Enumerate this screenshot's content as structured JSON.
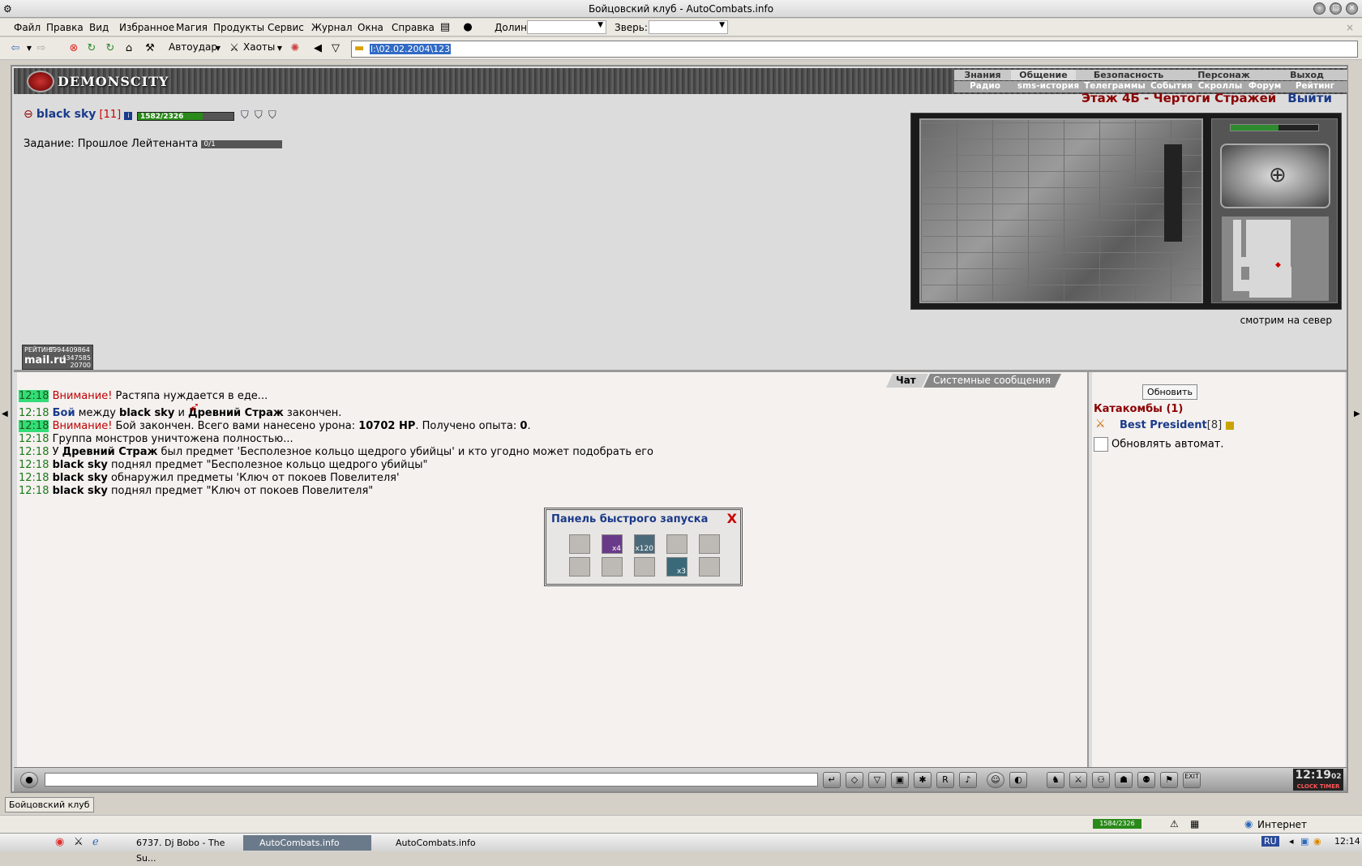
{
  "window": {
    "title": "Бойцовский клуб - AutoCombats.info"
  },
  "menubar": {
    "items": [
      "Файл",
      "Правка",
      "Вид",
      "Избранное",
      "Магия",
      "Продукты",
      "Сервис",
      "Журнал",
      "Окна",
      "Справка"
    ],
    "dolin_label": "Долин:",
    "zver_label": "Зверь:"
  },
  "toolbar": {
    "autoudar_label": "Автоудар",
    "haoty_label": "Хаоты",
    "address_value": "l:\\02.02.2004\\123"
  },
  "game": {
    "logo_text": "DEMONSCITY",
    "topnav": [
      "Знания",
      "Общение",
      "Безопасность",
      "Персонаж",
      "Выход"
    ],
    "subnav": [
      "Радио",
      "sms-история",
      "Телеграммы",
      "События",
      "Скроллы",
      "Форум",
      "Рейтинг"
    ],
    "character": {
      "name": "black sky",
      "level": "[11]",
      "hp_text": "1582/2326",
      "hp_fraction": 0.68
    },
    "task": {
      "label": "Задание: Прошлое Лейтенанта",
      "progress_text": "0/1"
    },
    "location": {
      "title": "Этаж 4Б - Чертоги Стражей",
      "exit_label": "Выйти"
    },
    "look_direction": "смотрим на север",
    "rating": {
      "label": "РЕЙТИНГ",
      "brand": "mail.ru",
      "n1": "5994409864",
      "n2": "4347585",
      "n3": "20700"
    }
  },
  "chat": {
    "tabs": [
      "Чат",
      "Системные сообщения"
    ],
    "messages": [
      {
        "time": "12:18",
        "highlight": true,
        "warn": "Внимание!",
        "text": " Растяпа нуждается в еде..."
      },
      {
        "time": "12:18",
        "highlight": false,
        "fight": "Бой",
        "text1": " между ",
        "b1": "black sky",
        "text2": " и ",
        "b2": "Древний Страж",
        "text3": " закончен."
      },
      {
        "time": "12:18",
        "highlight": true,
        "warn": "Внимание!",
        "text1": " Бой закончен. Всего вами нанесено урона: ",
        "b1": "10702 HP",
        "text2": ". Получено опыта: ",
        "b2": "0",
        "text3": "."
      },
      {
        "time": "12:18",
        "text": " Группа монстров уничтожена полностью..."
      },
      {
        "time": "12:18",
        "text1": " У ",
        "b1": "Древний Страж",
        "text2": " был предмет 'Бесполезное кольцо щедрого убийцы' и кто угодно может подобрать его"
      },
      {
        "time": "12:18",
        "b1": "black sky",
        "text2": " поднял предмет \"Бесполезное кольцо щедрого убийцы\""
      },
      {
        "time": "12:18",
        "b1": "black sky",
        "text2": " обнаружил предметы 'Ключ от покоев Повелителя'"
      },
      {
        "time": "12:18",
        "b1": "black sky",
        "text2": " поднял предмет \"Ключ от покоев Повелителя\""
      }
    ]
  },
  "quickpanel": {
    "title": "Панель быстрого запуска",
    "close": "X",
    "counts": [
      "",
      "x4",
      "x120",
      "",
      "",
      "",
      "",
      "",
      "x3",
      ""
    ]
  },
  "side": {
    "refresh_label": "Обновить",
    "catacombs": "Катакомбы (1)",
    "player": "Best President",
    "player_level": "[8]",
    "auto_label": "Обновлять автомат."
  },
  "bottombar": {
    "clock": "12:19",
    "clock_sec": "02",
    "clock_label": "CLOCK",
    "timer_label": "TIMER",
    "exit_label": "EXIT"
  },
  "status": {
    "tab_label": "Бойцовский клуб",
    "hp_mini": "1584/2326",
    "zone": "Интернет"
  },
  "taskbar": {
    "tasks": [
      "6737. Dj Bobo - The Su...",
      "AutoCombats.info",
      "AutoCombats.info"
    ],
    "lang": "RU",
    "time": "12:14"
  },
  "colors": {
    "accent_red": "#8b0000",
    "link_blue": "#1a3a8a",
    "hp_green": "#2a8a1a"
  }
}
